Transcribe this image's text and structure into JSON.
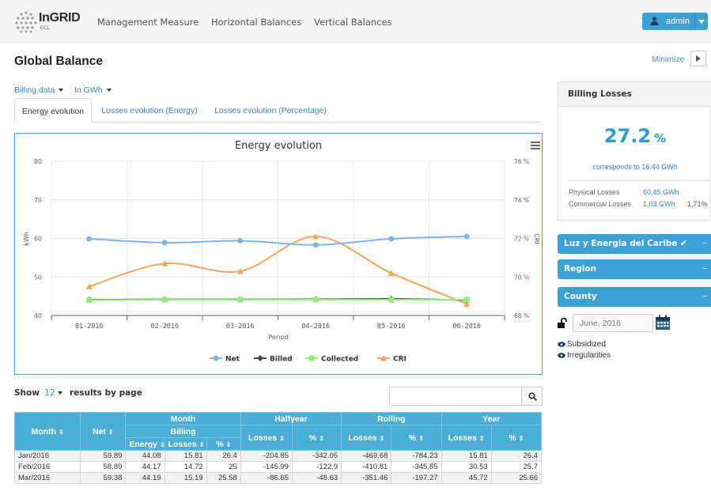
{
  "app": {
    "brand": "InGRID",
    "brand_sub": "ECL"
  },
  "nav": {
    "items": [
      "Management Measure",
      "Horizontal Balances",
      "Vertical Balances"
    ],
    "user_label": "admin"
  },
  "page": {
    "title": "Global Balance",
    "minimize_label": "Minimize"
  },
  "filters": {
    "data_source": "Billing data",
    "unit": "In GWh"
  },
  "tabs": [
    "Energy evolution",
    "Losses evolution (Energy)",
    "Losses evolution (Percentage)"
  ],
  "chart_data": {
    "type": "line",
    "title": "Energy evolution",
    "xlabel": "Period",
    "ylabel": "kWh",
    "y2label": "CRI",
    "categories": [
      "01-2016",
      "02-2016",
      "03-2016",
      "04-2016",
      "05-2016",
      "06-2016"
    ],
    "ylim": [
      40,
      80
    ],
    "yticks": [
      "40",
      "50",
      "60",
      "70",
      "80"
    ],
    "y2lim": [
      68,
      76
    ],
    "y2ticks": [
      "68 %",
      "70 %",
      "72 %",
      "74 %",
      "76 %"
    ],
    "grid": true,
    "legend_position": "bottom-center",
    "series": [
      {
        "name": "Net",
        "axis": "left",
        "color": "#7cb5ec",
        "marker": "circle",
        "values": [
          59.89,
          58.89,
          59.38,
          58.3,
          59.9,
          60.5
        ]
      },
      {
        "name": "Billed",
        "axis": "left",
        "color": "#434348",
        "marker": "diamond",
        "values": [
          44.08,
          44.17,
          44.19,
          44.2,
          44.3,
          44.0
        ]
      },
      {
        "name": "Collected",
        "axis": "left",
        "color": "#90ed7d",
        "marker": "square",
        "values": [
          44.0,
          44.1,
          44.1,
          44.1,
          44.1,
          44.1
        ]
      },
      {
        "name": "CRI",
        "axis": "right",
        "color": "#f7a35c",
        "marker": "triangle",
        "values": [
          69.5,
          70.7,
          70.3,
          72.1,
          70.2,
          68.6
        ]
      }
    ]
  },
  "table_controls": {
    "show_label": "Show",
    "page_size": "12",
    "results_label": "results by page",
    "search_value": ""
  },
  "table": {
    "group_headers": {
      "month": "Month",
      "halfyear": "Halfyear",
      "rolling": "Rolling",
      "year": "Year",
      "billing": "Billing"
    },
    "col_month": "Month",
    "col_net": "Net",
    "col_energy": "Energy",
    "col_losses": "Losses",
    "col_pct": "%",
    "rows": [
      [
        "Jan/2016",
        "59.89",
        "44.08",
        "15.81",
        "26.4",
        "-204.85",
        "-342.05",
        "-469.68",
        "-784.23",
        "15.81",
        "26.4"
      ],
      [
        "Feb/2016",
        "58.89",
        "44.17",
        "14.72",
        "25",
        "-145.99",
        "-122.9",
        "-410.81",
        "-345.85",
        "30.53",
        "25.7"
      ],
      [
        "Mar/2016",
        "59.38",
        "44.19",
        "15.19",
        "25.58",
        "-86.65",
        "-48.63",
        "-351.46",
        "-197.27",
        "45.72",
        "25.66"
      ]
    ]
  },
  "billing_losses": {
    "title": "Billing Losses",
    "value": "27.2",
    "unit": "%",
    "corresponds": "corresponds to 16.44 GWh",
    "physical_label": "Physical Losses",
    "physical_value": "60,45 GWh",
    "commercial_label": "Commercial Losses",
    "commercial_value": "1,03 GWh",
    "commercial_pct": "1,71%"
  },
  "sidebar_filters": {
    "company": "Luz y Energia del Caribe ✔",
    "region": "Region",
    "county": "County",
    "date_placeholder": "June, 2016",
    "legend": [
      "Subsidized",
      "Irregularities"
    ]
  },
  "colors": {
    "accent": "#3da1d6",
    "table_header": "#4aaed6",
    "link": "#3a86c8"
  }
}
